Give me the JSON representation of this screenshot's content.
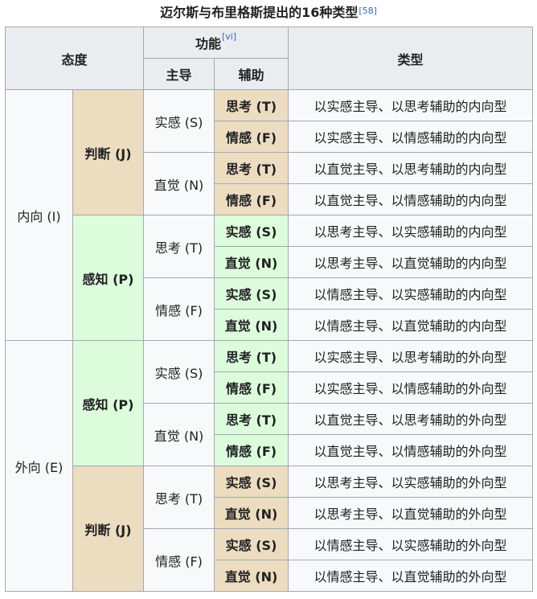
{
  "caption": {
    "text": "迈尔斯与布里格斯提出的16种类型",
    "ref": "[58]"
  },
  "header": {
    "attitude": "态度",
    "function": "功能",
    "function_ref": "[vi]",
    "dominant": "主导",
    "auxiliary": "辅助",
    "type": "类型"
  },
  "colors": {
    "judging": "#ecdcc0",
    "perceiving": "#dcfcdc",
    "header": "#eaecf0",
    "cell": "#f8f9fa",
    "border": "#a2a9b1",
    "link": "#3366cc"
  },
  "groups": [
    {
      "attitude": "内向 (I)",
      "lifestyles": [
        {
          "label": "判断 (J)",
          "color": "judging",
          "dominants": [
            {
              "label": "实感 (S)",
              "rows": [
                {
                  "aux": "思考 (T)",
                  "desc": "以实感主导、以思考辅助的内向型"
                },
                {
                  "aux": "情感 (F)",
                  "desc": "以实感主导、以情感辅助的内向型"
                }
              ]
            },
            {
              "label": "直觉 (N)",
              "rows": [
                {
                  "aux": "思考 (T)",
                  "desc": "以直觉主导、以思考辅助的内向型"
                },
                {
                  "aux": "情感 (F)",
                  "desc": "以直觉主导、以情感辅助的内向型"
                }
              ]
            }
          ]
        },
        {
          "label": "感知 (P)",
          "color": "perceiving",
          "dominants": [
            {
              "label": "思考 (T)",
              "rows": [
                {
                  "aux": "实感 (S)",
                  "desc": "以思考主导、以实感辅助的内向型"
                },
                {
                  "aux": "直觉 (N)",
                  "desc": "以思考主导、以直觉辅助的内向型"
                }
              ]
            },
            {
              "label": "情感 (F)",
              "rows": [
                {
                  "aux": "实感 (S)",
                  "desc": "以情感主导、以实感辅助的内向型"
                },
                {
                  "aux": "直觉 (N)",
                  "desc": "以情感主导、以直觉辅助的内向型"
                }
              ]
            }
          ]
        }
      ]
    },
    {
      "attitude": "外向 (E)",
      "lifestyles": [
        {
          "label": "感知 (P)",
          "color": "perceiving",
          "dominants": [
            {
              "label": "实感 (S)",
              "rows": [
                {
                  "aux": "思考 (T)",
                  "desc": "以实感主导、以思考辅助的外向型"
                },
                {
                  "aux": "情感 (F)",
                  "desc": "以实感主导、以情感辅助的外向型"
                }
              ]
            },
            {
              "label": "直觉 (N)",
              "rows": [
                {
                  "aux": "思考 (T)",
                  "desc": "以直觉主导、以思考辅助的外向型"
                },
                {
                  "aux": "情感 (F)",
                  "desc": "以直觉主导、以情感辅助的外向型"
                }
              ]
            }
          ]
        },
        {
          "label": "判断 (J)",
          "color": "judging",
          "dominants": [
            {
              "label": "思考 (T)",
              "rows": [
                {
                  "aux": "实感 (S)",
                  "desc": "以思考主导、以实感辅助的外向型"
                },
                {
                  "aux": "直觉 (N)",
                  "desc": "以思考主导、以直觉辅助的外向型"
                }
              ]
            },
            {
              "label": "情感 (F)",
              "rows": [
                {
                  "aux": "实感 (S)",
                  "desc": "以情感主导、以实感辅助的外向型"
                },
                {
                  "aux": "直觉 (N)",
                  "desc": "以情感主导、以直觉辅助的外向型"
                }
              ]
            }
          ]
        }
      ]
    }
  ]
}
